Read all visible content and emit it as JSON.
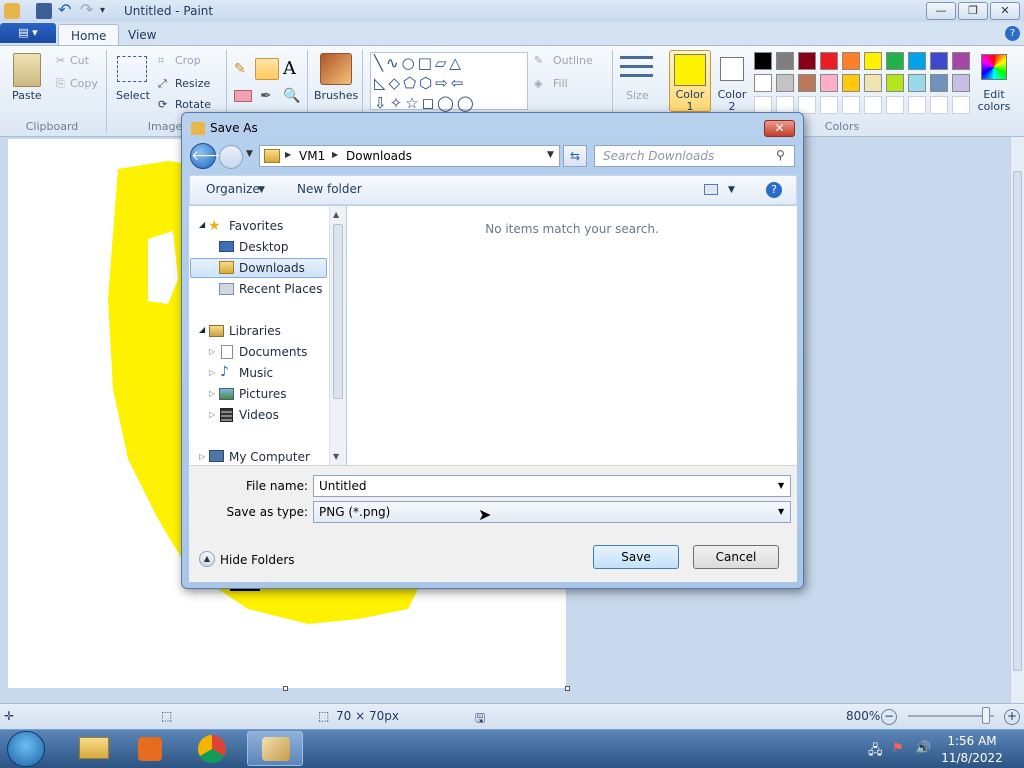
{
  "window": {
    "title": "Untitled - Paint"
  },
  "ribbon": {
    "app_menu": "▤ ▾",
    "tabs": [
      "Home",
      "View"
    ],
    "clipboard": {
      "paste": "Paste",
      "cut": "Cut",
      "copy": "Copy",
      "label": "Clipboard"
    },
    "image": {
      "select": "Select",
      "crop": "Crop",
      "resize": "Resize",
      "rotate": "Rotate",
      "label": "Image"
    },
    "tools": {
      "text_icon": "A"
    },
    "brushes": "Brushes",
    "shapes": {
      "outline": "Outline",
      "fill": "Fill"
    },
    "size": "Size",
    "color1": {
      "label": "Color 1",
      "value": "#FFF200"
    },
    "color2": {
      "label": "Color 2",
      "value": "#FFFFFF"
    },
    "colors_label": "Colors",
    "edit_colors": "Edit colors",
    "palette": [
      "#000000",
      "#7F7F7F",
      "#880015",
      "#ED1C24",
      "#FF7F27",
      "#FFF200",
      "#22B14C",
      "#00A2E8",
      "#3F48CC",
      "#A349A4",
      "#FFFFFF",
      "#C3C3C3",
      "#B97A57",
      "#FFAEC9",
      "#FFC90E",
      "#EFE4B0",
      "#B5E61D",
      "#99D9EA",
      "#7092BE",
      "#C8BFE7"
    ]
  },
  "dialog": {
    "title": "Save As",
    "close": "✕",
    "address": {
      "segments": [
        "VM1",
        "Downloads"
      ]
    },
    "search_placeholder": "Search Downloads",
    "commands": {
      "organize": "Organize",
      "new_folder": "New folder"
    },
    "nav": {
      "favorites": "Favorites",
      "favorites_items": [
        "Desktop",
        "Downloads",
        "Recent Places"
      ],
      "libraries": "Libraries",
      "libraries_items": [
        "Documents",
        "Music",
        "Pictures",
        "Videos"
      ],
      "computer": "My Computer"
    },
    "empty_message": "No items match your search.",
    "file_name_label": "File name:",
    "file_name_value": "Untitled",
    "save_type_label": "Save as type:",
    "save_type_value": "PNG (*.png)",
    "hide_folders": "Hide Folders",
    "save": "Save",
    "cancel": "Cancel"
  },
  "status": {
    "dimensions": "70 × 70px",
    "zoom": "800%"
  },
  "taskbar": {
    "time": "1:56 AM",
    "date": "11/8/2022"
  }
}
